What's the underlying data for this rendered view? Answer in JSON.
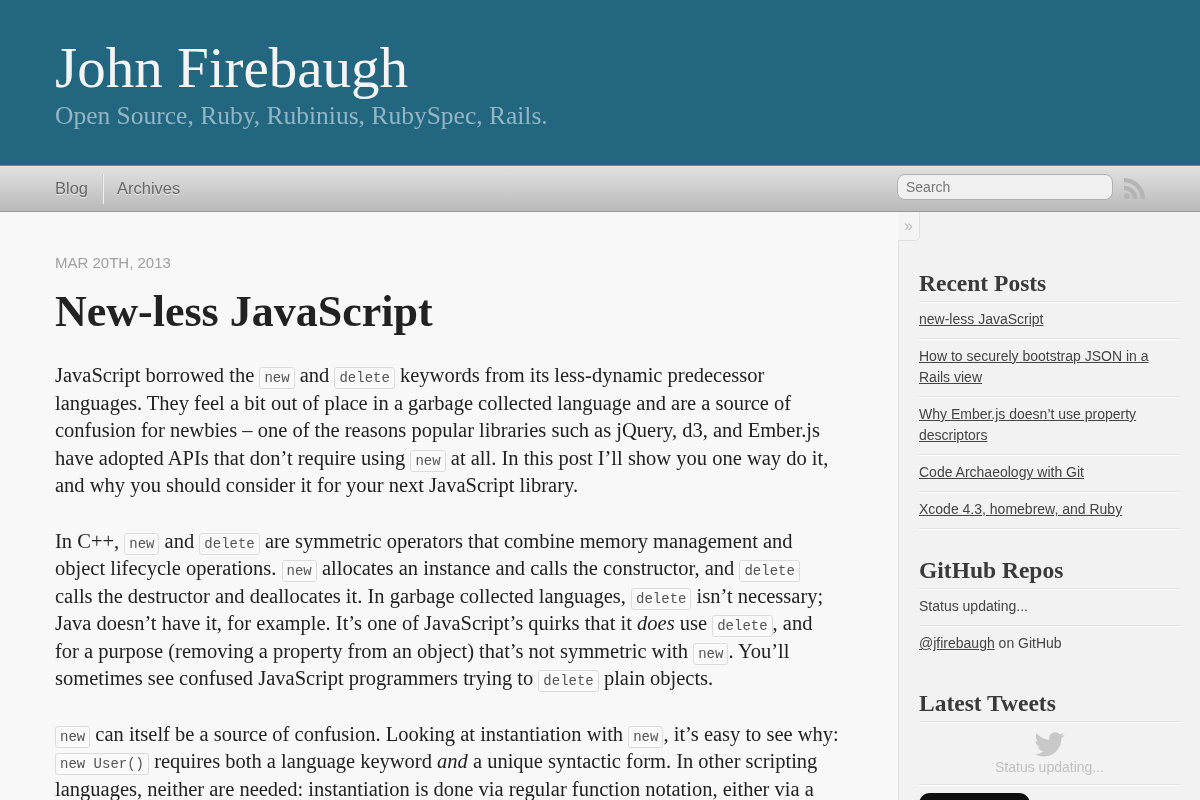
{
  "header": {
    "title": "John Firebaugh",
    "subtitle": "Open Source, Ruby, Rubinius, RubySpec, Rails."
  },
  "nav": {
    "links": [
      "Blog",
      "Archives"
    ],
    "search": {
      "placeholder": "Search"
    }
  },
  "article": {
    "date": "MAR 20TH, 2013",
    "title": "New-less JavaScript",
    "paragraphs": [
      [
        {
          "kind": "text",
          "text": "JavaScript borrowed the "
        },
        {
          "kind": "code",
          "text": "new"
        },
        {
          "kind": "text",
          "text": " and "
        },
        {
          "kind": "code",
          "text": "delete"
        },
        {
          "kind": "text",
          "text": " keywords from its less-dynamic predecessor languages. They feel a bit out of place in a garbage collected language and are a source of confusion for newbies – one of the reasons popular libraries such as jQuery, d3, and Ember.js have adopted APIs that don’t require using "
        },
        {
          "kind": "code",
          "text": "new"
        },
        {
          "kind": "text",
          "text": " at all. In this post I’ll show you one way do it, and why you should consider it for your next JavaScript library."
        }
      ],
      [
        {
          "kind": "text",
          "text": "In C++, "
        },
        {
          "kind": "code",
          "text": "new"
        },
        {
          "kind": "text",
          "text": " and "
        },
        {
          "kind": "code",
          "text": "delete"
        },
        {
          "kind": "text",
          "text": " are symmetric operators that combine memory management and object lifecycle operations. "
        },
        {
          "kind": "code",
          "text": "new"
        },
        {
          "kind": "text",
          "text": " allocates an instance and calls the constructor, and "
        },
        {
          "kind": "code",
          "text": "delete"
        },
        {
          "kind": "text",
          "text": " calls the destructor and deallocates it. In garbage collected languages, "
        },
        {
          "kind": "code",
          "text": "delete"
        },
        {
          "kind": "text",
          "text": " isn’t necessary; Java doesn’t have it, for example. It’s one of JavaScript’s quirks that it *does* use "
        },
        {
          "kind": "code",
          "text": "delete"
        },
        {
          "kind": "text",
          "text": ", and for a purpose (removing a property from an object) that’s not symmetric with "
        },
        {
          "kind": "code",
          "text": "new"
        },
        {
          "kind": "text",
          "text": ". You’ll sometimes see confused JavaScript programmers trying to "
        },
        {
          "kind": "code",
          "text": "delete"
        },
        {
          "kind": "text",
          "text": " plain objects."
        }
      ],
      [
        {
          "kind": "code",
          "text": "new"
        },
        {
          "kind": "text",
          "text": " can itself be a source of confusion. Looking at instantiation with "
        },
        {
          "kind": "code",
          "text": "new"
        },
        {
          "kind": "text",
          "text": ", it’s easy to see why: "
        },
        {
          "kind": "code",
          "text": "new User()"
        },
        {
          "kind": "text",
          "text": " requires both a language keyword *and* a unique syntactic form. In other scripting languages, neither are needed: instantiation is done via regular function notation, either via a"
        }
      ]
    ]
  },
  "sidebar": {
    "toggle": "»",
    "sections": [
      {
        "kind": "links",
        "title": "Recent Posts",
        "items": [
          "new-less JavaScript",
          "How to securely bootstrap JSON in a Rails view",
          "Why Ember.js doesn’t use property descriptors",
          "Code Archaeology with Git",
          "Xcode 4.3, homebrew, and Ruby"
        ]
      },
      {
        "kind": "github",
        "title": "GitHub Repos",
        "status": "Status updating...",
        "profile": {
          "link": "@jfirebaugh",
          "text": "on GitHub"
        }
      },
      {
        "kind": "tweets",
        "title": "Latest Tweets",
        "status": "Status updating...",
        "follow_button": true
      }
    ]
  }
}
